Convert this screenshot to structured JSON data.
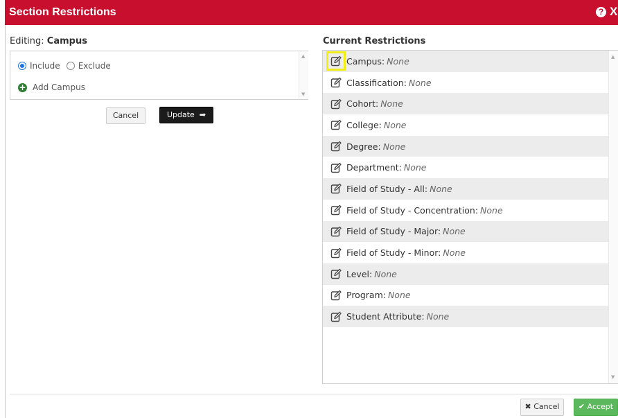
{
  "dialog": {
    "title": "Section Restrictions",
    "help_glyph": "?",
    "close_glyph": "X"
  },
  "editing": {
    "prefix": "Editing: ",
    "name": "Campus",
    "include_label": "Include",
    "exclude_label": "Exclude",
    "selected": "Include",
    "add_label": "Add Campus",
    "cancel_label": "Cancel",
    "update_label": "Update"
  },
  "restrictions": {
    "heading": "Current Restrictions",
    "items": [
      {
        "label": "Campus:",
        "value": "None"
      },
      {
        "label": "Classification:",
        "value": "None"
      },
      {
        "label": "Cohort:",
        "value": "None"
      },
      {
        "label": "College:",
        "value": "None"
      },
      {
        "label": "Degree:",
        "value": "None"
      },
      {
        "label": "Department:",
        "value": "None"
      },
      {
        "label": "Field of Study - All:",
        "value": "None"
      },
      {
        "label": "Field of Study - Concentration:",
        "value": "None"
      },
      {
        "label": "Field of Study - Major:",
        "value": "None"
      },
      {
        "label": "Field of Study - Minor:",
        "value": "None"
      },
      {
        "label": "Level:",
        "value": "None"
      },
      {
        "label": "Program:",
        "value": "None"
      },
      {
        "label": "Student Attribute:",
        "value": "None"
      }
    ]
  },
  "footer": {
    "cancel_label": "Cancel",
    "accept_label": "Accept"
  },
  "colors": {
    "titlebar": "#c8102e",
    "accept": "#5cb85c",
    "highlight": "#f2ee1a"
  }
}
